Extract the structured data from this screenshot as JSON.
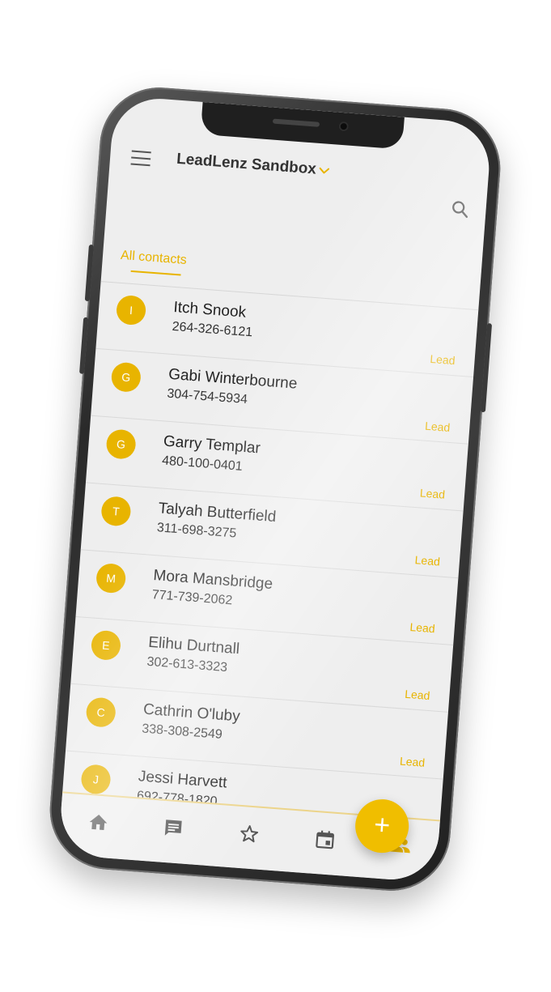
{
  "header": {
    "title": "LeadLenz Sandbox"
  },
  "tabs": [
    {
      "label": "All contacts",
      "active": true
    }
  ],
  "contacts": [
    {
      "initial": "I",
      "name": "Itch Snook",
      "phone": "264-326-6121",
      "tag": "Lead"
    },
    {
      "initial": "G",
      "name": "Gabi Winterbourne",
      "phone": "304-754-5934",
      "tag": "Lead"
    },
    {
      "initial": "G",
      "name": "Garry Templar",
      "phone": "480-100-0401",
      "tag": "Lead"
    },
    {
      "initial": "T",
      "name": "Talyah Butterfield",
      "phone": "311-698-3275",
      "tag": "Lead"
    },
    {
      "initial": "M",
      "name": "Mora Mansbridge",
      "phone": "771-739-2062",
      "tag": "Lead"
    },
    {
      "initial": "E",
      "name": "Elihu Durtnall",
      "phone": "302-613-3323",
      "tag": "Lead"
    },
    {
      "initial": "C",
      "name": "Cathrin O'luby",
      "phone": "338-308-2549",
      "tag": "Lead"
    },
    {
      "initial": "J",
      "name": "Jessi Harvett",
      "phone": "692-778-1820"
    }
  ],
  "fab": {
    "label": "+"
  },
  "bottom_nav": [
    {
      "icon": "home-icon",
      "active": false
    },
    {
      "icon": "message-icon",
      "active": false
    },
    {
      "icon": "star-icon",
      "active": false
    },
    {
      "icon": "calendar-icon",
      "active": false
    },
    {
      "icon": "people-icon",
      "active": true
    }
  ],
  "colors": {
    "accent": "#e8b400",
    "fab": "#f0be00",
    "text_primary": "#222222",
    "icon_inactive": "#555555"
  }
}
